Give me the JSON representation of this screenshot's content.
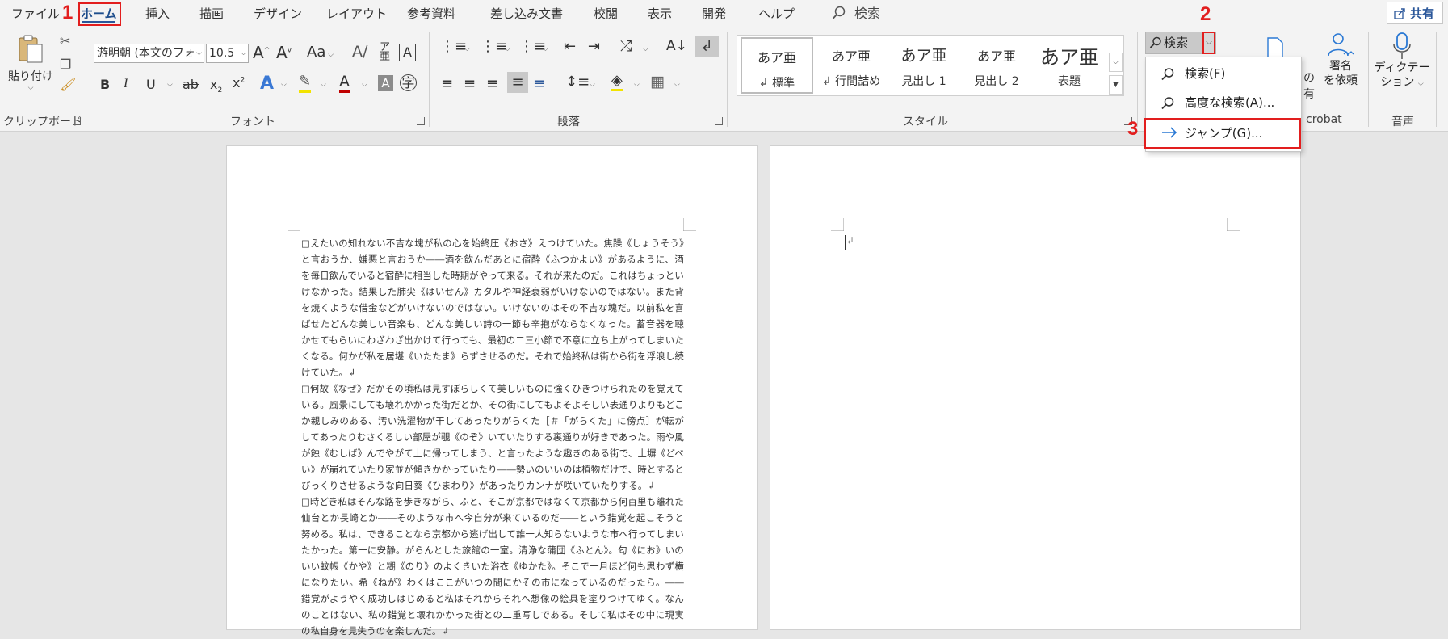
{
  "tabs": [
    {
      "label": "ファイル",
      "active": false
    },
    {
      "label": "ホーム",
      "active": true
    },
    {
      "label": "挿入",
      "active": false
    },
    {
      "label": "描画",
      "active": false
    },
    {
      "label": "デザイン",
      "active": false
    },
    {
      "label": "レイアウト",
      "active": false
    },
    {
      "label": "参考資料",
      "active": false
    },
    {
      "label": "差し込み文書",
      "active": false
    },
    {
      "label": "校閲",
      "active": false
    },
    {
      "label": "表示",
      "active": false
    },
    {
      "label": "開発",
      "active": false
    },
    {
      "label": "ヘルプ",
      "active": false
    }
  ],
  "tell_me": "検索",
  "share": "共有",
  "ribbon": {
    "clipboard": {
      "paste": "貼り付け",
      "label": "クリップボード"
    },
    "font": {
      "name": "游明朝 (本文のフォ",
      "size": "10.5",
      "change_case": "Aa",
      "label": "フォント"
    },
    "paragraph": {
      "label": "段落"
    },
    "styles": {
      "label": "スタイル",
      "items": [
        {
          "sample": "あア亜",
          "name": "↲ 標準",
          "selected": true
        },
        {
          "sample": "あア亜",
          "name": "↲ 行間詰め",
          "selected": false
        },
        {
          "sample": "あア亜",
          "name": "見出し 1",
          "selected": false
        },
        {
          "sample": "あア亜",
          "name": "見出し 2",
          "selected": false
        },
        {
          "sample": "あア亜",
          "name": "表題",
          "selected": false
        }
      ]
    },
    "editing": {
      "search_label": "検索"
    },
    "share_group": {
      "line1": "の",
      "line2": "有"
    },
    "acrobat": {
      "sign_line1": "署名",
      "sign_line2": "を依頼",
      "label": "crobat"
    },
    "voice": {
      "dictate_line1": "ディクテー",
      "dictate_line2": "ション",
      "label": "音声"
    }
  },
  "search_menu": [
    {
      "label": "検索(F)",
      "icon": "magnifier-icon"
    },
    {
      "label": "高度な検索(A)...",
      "icon": "magnifier-icon"
    },
    {
      "label": "ジャンプ(G)...",
      "icon": "arrow-right-icon"
    }
  ],
  "annotations": [
    "1",
    "2",
    "3"
  ],
  "document": {
    "paragraphs": [
      "□えたいの知れない不吉な塊が私の心を始終圧《おさ》えつけていた。焦躁《しょうそう》と言おうか、嫌悪と言おうか――酒を飲んだあとに宿酔《ふつかよい》があるように、酒を毎日飲んでいると宿酔に相当した時期がやって来る。それが来たのだ。これはちょっといけなかった。結果した肺尖《はいせん》カタルや神経衰弱がいけないのではない。また背を焼くような借金などがいけないのではない。いけないのはその不吉な塊だ。以前私を喜ばせたどんな美しい音楽も、どんな美しい詩の一節も辛抱がならなくなった。蓄音器を聴かせてもらいにわざわざ出かけて行っても、最初の二三小節で不意に立ち上がってしまいたくなる。何かが私を居堪《いたたま》らずさせるのだ。それで始終私は街から街を浮浪し続けていた。↲",
      "□何故《なぜ》だかその頃私は見すぼらしくて美しいものに強くひきつけられたのを覚えている。風景にしても壊れかかった街だとか、その街にしてもよそよそしい表通りよりもどこか親しみのある、汚い洗濯物が干してあったりがらくた［＃「がらくた」に傍点］が転がしてあったりむさくるしい部屋が覗《のぞ》いていたりする裏通りが好きであった。雨や風が蝕《むしば》んでやがて土に帰ってしまう、と言ったような趣きのある街で、土塀《どべい》が崩れていたり家並が傾きかかっていたり――勢いのいいのは植物だけで、時とするとびっくりさせるような向日葵《ひまわり》があったりカンナが咲いていたりする。↲",
      "□時どき私はそんな路を歩きながら、ふと、そこが京都ではなくて京都から何百里も離れた仙台とか長崎とか――そのような市へ今自分が来ているのだ――という錯覚を起こそうと努める。私は、できることなら京都から逃げ出して誰一人知らないような市へ行ってしまいたかった。第一に安静。がらんとした旅館の一室。清浄な蒲団《ふとん》。匂《にお》いのいい蚊帳《かや》と糊《のり》のよくきいた浴衣《ゆかた》。そこで一月ほど何も思わず横になりたい。希《ねが》わくはここがいつの間にかその市になっているのだったら。――錯覚がようやく成功しはじめると私はそれからそれへ想像の絵具を塗りつけてゆく。なんのことはない、私の錯覚と壊れかかった街との二重写しである。そして私はその中に現実の私自身を見失うのを楽しんだ。↲"
    ]
  }
}
